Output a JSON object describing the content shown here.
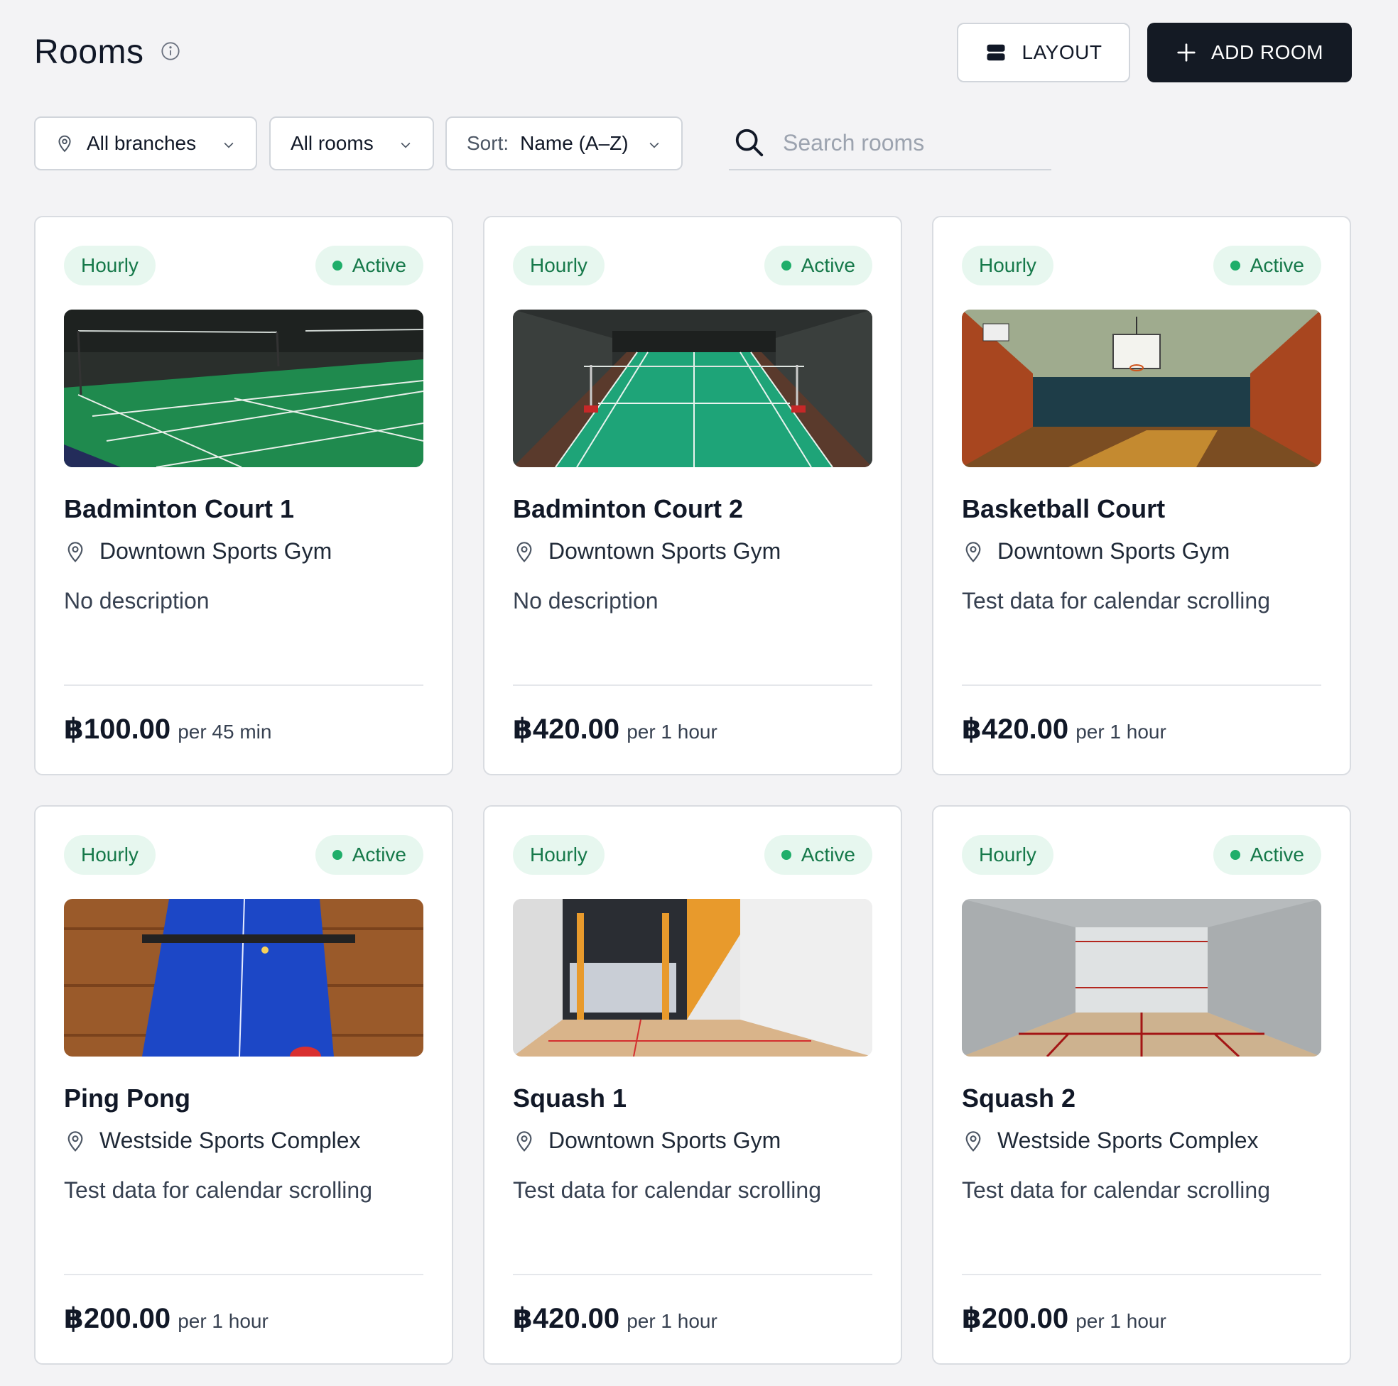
{
  "header": {
    "title": "Rooms",
    "layout_label": "LAYOUT",
    "add_label": "ADD ROOM"
  },
  "filters": {
    "branch": "All branches",
    "rooms": "All rooms",
    "sort_prefix": "Sort:",
    "sort_value": "Name (A–Z)",
    "search_placeholder": "Search rooms"
  },
  "colors": {
    "accent_dark": "#141a24",
    "badge_bg": "#e7f7ef",
    "badge_text": "#16794a",
    "active_dot": "#1fae6a"
  },
  "rooms": [
    {
      "type": "Hourly",
      "status": "Active",
      "name": "Badminton Court 1",
      "location": "Downtown Sports Gym",
      "description": "No description",
      "price": "฿100.00",
      "per": "per 45 min",
      "image": "badminton-court-photo"
    },
    {
      "type": "Hourly",
      "status": "Active",
      "name": "Badminton Court 2",
      "location": "Downtown Sports Gym",
      "description": "No description",
      "price": "฿420.00",
      "per": "per 1 hour",
      "image": "badminton-court-photo"
    },
    {
      "type": "Hourly",
      "status": "Active",
      "name": "Basketball Court",
      "location": "Downtown Sports Gym",
      "description": "Test data for calendar scrolling",
      "price": "฿420.00",
      "per": "per 1 hour",
      "image": "basketball-court-photo"
    },
    {
      "type": "Hourly",
      "status": "Active",
      "name": "Ping Pong",
      "location": "Westside Sports Complex",
      "description": "Test data for calendar scrolling",
      "price": "฿200.00",
      "per": "per 1 hour",
      "image": "ping-pong-table-photo"
    },
    {
      "type": "Hourly",
      "status": "Active",
      "name": "Squash 1",
      "location": "Downtown Sports Gym",
      "description": "Test data for calendar scrolling",
      "price": "฿420.00",
      "per": "per 1 hour",
      "image": "squash-court-photo"
    },
    {
      "type": "Hourly",
      "status": "Active",
      "name": "Squash 2",
      "location": "Westside Sports Complex",
      "description": "Test data for calendar scrolling",
      "price": "฿200.00",
      "per": "per 1 hour",
      "image": "squash-court-photo"
    }
  ]
}
